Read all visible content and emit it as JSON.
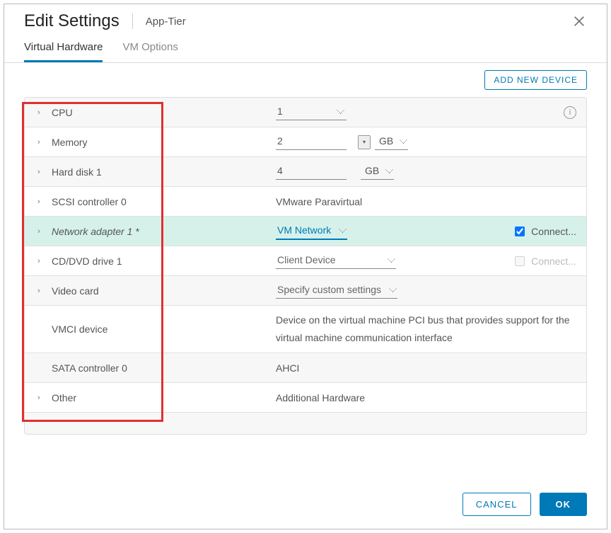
{
  "header": {
    "title": "Edit Settings",
    "vm_name": "App-Tier"
  },
  "tabs": {
    "hardware": "Virtual Hardware",
    "options": "VM Options"
  },
  "toolbar": {
    "add_device": "ADD NEW DEVICE"
  },
  "rows": {
    "cpu": {
      "label": "CPU",
      "value": "1"
    },
    "memory": {
      "label": "Memory",
      "value": "2",
      "unit": "GB"
    },
    "disk": {
      "label": "Hard disk 1",
      "value": "4",
      "unit": "GB"
    },
    "scsi": {
      "label": "SCSI controller 0",
      "value": "VMware Paravirtual"
    },
    "net": {
      "label": "Network adapter 1 *",
      "value": "VM Network",
      "connect": "Connect..."
    },
    "cd": {
      "label": "CD/DVD drive 1",
      "value": "Client Device",
      "connect": "Connect..."
    },
    "video": {
      "label": "Video card",
      "value": "Specify custom settings"
    },
    "vmci": {
      "label": "VMCI device",
      "value": "Device on the virtual machine PCI bus that provides support for the virtual machine communication interface"
    },
    "sata": {
      "label": "SATA controller 0",
      "value": "AHCI"
    },
    "other": {
      "label": "Other",
      "value": "Additional Hardware"
    }
  },
  "footer": {
    "cancel": "CANCEL",
    "ok": "OK"
  }
}
